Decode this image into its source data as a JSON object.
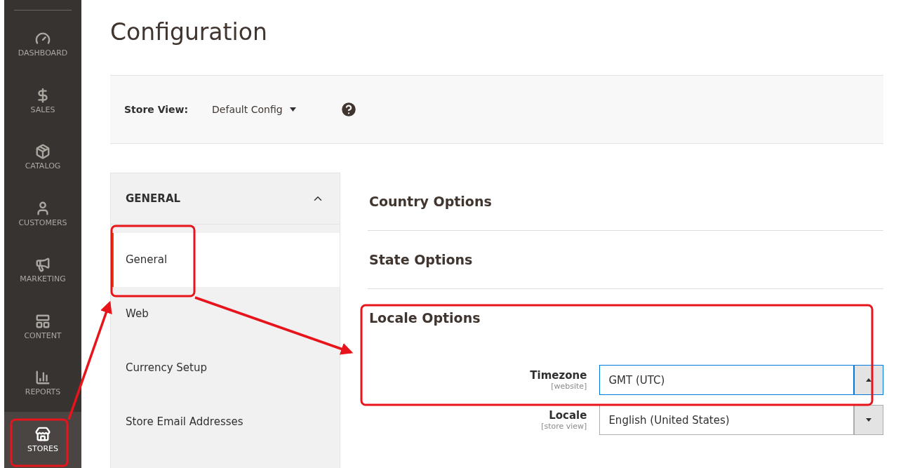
{
  "sidebar": {
    "items": [
      {
        "kind": "dashboard",
        "label": "DASHBOARD",
        "selected": false
      },
      {
        "kind": "sales",
        "label": "SALES",
        "selected": false
      },
      {
        "kind": "catalog",
        "label": "CATALOG",
        "selected": false
      },
      {
        "kind": "customers",
        "label": "CUSTOMERS",
        "selected": false
      },
      {
        "kind": "marketing",
        "label": "MARKETING",
        "selected": false
      },
      {
        "kind": "content",
        "label": "CONTENT",
        "selected": false
      },
      {
        "kind": "reports",
        "label": "REPORTS",
        "selected": false
      },
      {
        "kind": "stores",
        "label": "STORES",
        "selected": true
      }
    ]
  },
  "page_title": "Configuration",
  "scope_bar": {
    "label": "Store View:",
    "value": "Default Config"
  },
  "config_nav": {
    "group": {
      "title": "GENERAL",
      "expanded": true
    },
    "items": [
      {
        "label": "General",
        "selected": true
      },
      {
        "label": "Web",
        "selected": false
      },
      {
        "label": "Currency Setup",
        "selected": false
      },
      {
        "label": "Store Email Addresses",
        "selected": false
      }
    ]
  },
  "sections": [
    {
      "title": "Country Options",
      "expanded": false
    },
    {
      "title": "State Options",
      "expanded": false
    },
    {
      "title": "Locale Options",
      "expanded": true,
      "fields": [
        {
          "label": "Timezone",
          "scope": "[website]",
          "value": "GMT (UTC)",
          "expanded": true
        },
        {
          "label": "Locale",
          "scope": "[store view]",
          "value": "English (United States)",
          "expanded": false
        }
      ]
    }
  ]
}
